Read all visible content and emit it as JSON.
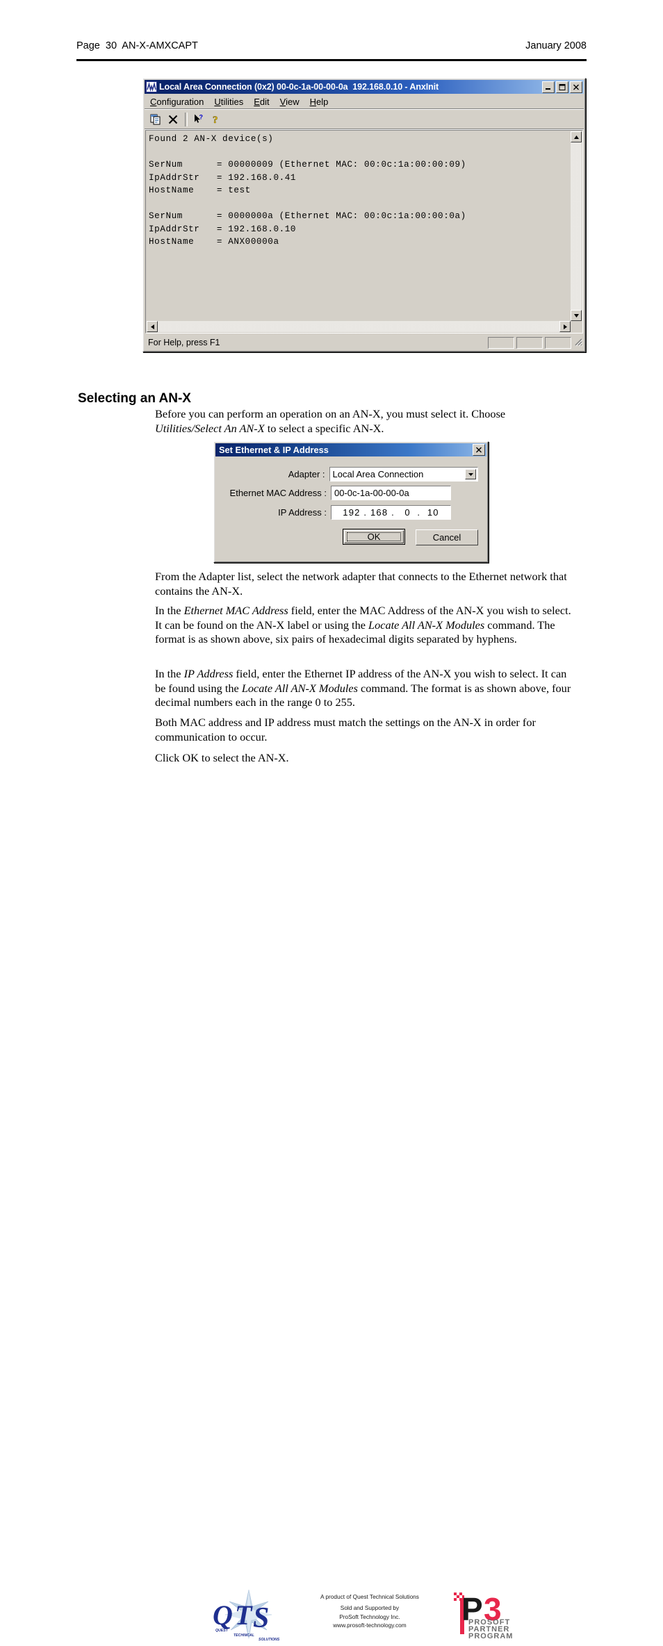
{
  "page": {
    "header_left": "Page  30  AN-X-AMXCAPT",
    "header_right": "January 2008"
  },
  "anxinit_window": {
    "app_icon": "anxinit-app-icon",
    "title": "Local Area Connection (0x2) 00-0c-1a-00-00-0a  192.168.0.10 - AnxInit",
    "caption_buttons": [
      {
        "name": "minimize-button",
        "glyph": "minimize-icon"
      },
      {
        "name": "maximize-button",
        "glyph": "maximize-icon"
      },
      {
        "name": "close-button",
        "glyph": "close-icon"
      }
    ],
    "menu": [
      {
        "label": "Configuration",
        "accel": "C"
      },
      {
        "label": "Utilities",
        "accel": "U"
      },
      {
        "label": "Edit",
        "accel": "E"
      },
      {
        "label": "View",
        "accel": "V"
      },
      {
        "label": "Help",
        "accel": "H"
      }
    ],
    "toolbar": [
      {
        "name": "copy-button",
        "icon": "copy-icon"
      },
      {
        "name": "clear-button",
        "icon": "x-delete-icon"
      },
      {
        "name": "context-help-button",
        "icon": "arrow-question-icon"
      },
      {
        "name": "help-button",
        "icon": "question-mark-icon"
      }
    ],
    "console": "Found 2 AN-X device(s)\n\nSerNum      = 00000009 (Ethernet MAC: 00:0c:1a:00:00:09)\nIpAddrStr   = 192.168.0.41\nHostName    = test\n\nSerNum      = 0000000a (Ethernet MAC: 00:0c:1a:00:00:0a)\nIpAddrStr   = 192.168.0.10\nHostName    = ANX00000a",
    "status_text": "For Help, press F1"
  },
  "section": {
    "heading": "Selecting an AN-X"
  },
  "paragraphs": {
    "intro_a": "Before you can perform an operation on an AN-X, you must select it.  Choose ",
    "intro_italic": "Utilities/Select An AN-X",
    "intro_b": " to select a specific AN-X.",
    "p_adapter": "From the Adapter list, select the network adapter that connects to the Ethernet network that contains the AN-X.",
    "p_mac_a": "In the ",
    "p_mac_i1": "Ethernet MAC Address",
    "p_mac_b": " field, enter the MAC Address of the AN-X you wish to select.  It can be found on the AN-X label or using the ",
    "p_mac_i2": "Locate All AN-X Modules",
    "p_mac_c": " command.  The format is as shown above, six pairs of hexadecimal digits separated by hyphens.",
    "p_ip_a": "In the ",
    "p_ip_i1": "IP Address",
    "p_ip_b": " field, enter the Ethernet IP address of the AN-X you wish to select.  It can be found using the ",
    "p_ip_i2": "Locate All AN-X Modules",
    "p_ip_c": " command.  The format is as shown above, four decimal numbers each in the range 0 to 255.",
    "p_both": "Both MAC address and IP address must match the settings on the AN-X in order for communication to occur.",
    "p_click": "Click OK to select the AN-X."
  },
  "dialog": {
    "title": "Set Ethernet & IP Address",
    "close_icon": "close-icon",
    "adapter_label": "Adapter :",
    "adapter_value": "Local Area Connection",
    "mac_label": "Ethernet MAC Address :",
    "mac_value": "00-0c-1a-00-00-0a",
    "ip_label": "IP Address :",
    "ip_value": "192 . 168 .   0  .  10",
    "ok_label": "OK",
    "cancel_label": "Cancel"
  },
  "footer": {
    "qts_logo_alt": "qts-quest-technical-solutions-logo",
    "center_line1": "A product of Quest Technical Solutions",
    "center_line2": "Sold and Supported by",
    "center_line3": "ProSoft Technology Inc.",
    "center_line4": "www.prosoft-technology.com",
    "p3_logo_alt": "p3-prosoft-partner-program-logo"
  },
  "colors": {
    "title_active_start": "#0a246a",
    "title_active_end": "#a6caf0",
    "window_face": "#d4d0c8",
    "p3_red": "#e8274b",
    "p3_black": "#1a1a1a",
    "qts_blue": "#1f2f8f"
  }
}
